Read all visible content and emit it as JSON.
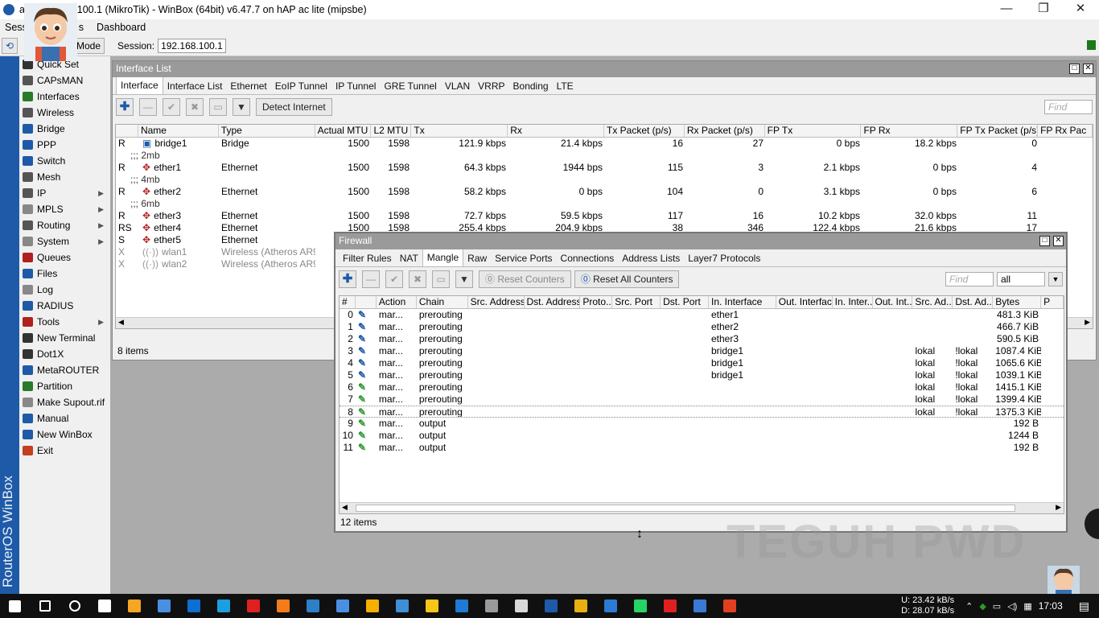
{
  "titlebar": {
    "title": "a    @192.168.100.1 (MikroTik) - WinBox (64bit) v6.47.7 on hAP ac lite (mipsbe)",
    "min": "—",
    "max": "❐",
    "close": "✕"
  },
  "menu": {
    "session": "Sess",
    "settings": "s",
    "dashboard": "Dashboard"
  },
  "toolbar": {
    "mode": "Mode",
    "session_label": "Session:",
    "session_value": "192.168.100.1"
  },
  "vertical_label": "RouterOS WinBox",
  "sidebar": {
    "items": [
      {
        "label": "Quick Set",
        "icon": "quick-set-icon",
        "arrow": false
      },
      {
        "label": "CAPsMAN",
        "icon": "capsman-icon",
        "arrow": false
      },
      {
        "label": "Interfaces",
        "icon": "interfaces-icon",
        "arrow": false
      },
      {
        "label": "Wireless",
        "icon": "wireless-icon",
        "arrow": false
      },
      {
        "label": "Bridge",
        "icon": "bridge-icon",
        "arrow": false
      },
      {
        "label": "PPP",
        "icon": "ppp-icon",
        "arrow": false
      },
      {
        "label": "Switch",
        "icon": "switch-icon",
        "arrow": false
      },
      {
        "label": "Mesh",
        "icon": "mesh-icon",
        "arrow": false
      },
      {
        "label": "IP",
        "icon": "ip-icon",
        "arrow": true
      },
      {
        "label": "MPLS",
        "icon": "mpls-icon",
        "arrow": true
      },
      {
        "label": "Routing",
        "icon": "routing-icon",
        "arrow": true
      },
      {
        "label": "System",
        "icon": "system-icon",
        "arrow": true
      },
      {
        "label": "Queues",
        "icon": "queues-icon",
        "arrow": false
      },
      {
        "label": "Files",
        "icon": "files-icon",
        "arrow": false
      },
      {
        "label": "Log",
        "icon": "log-icon",
        "arrow": false
      },
      {
        "label": "RADIUS",
        "icon": "radius-icon",
        "arrow": false
      },
      {
        "label": "Tools",
        "icon": "tools-icon",
        "arrow": true
      },
      {
        "label": "New Terminal",
        "icon": "terminal-icon",
        "arrow": false
      },
      {
        "label": "Dot1X",
        "icon": "dot1x-icon",
        "arrow": false
      },
      {
        "label": "MetaROUTER",
        "icon": "metarouter-icon",
        "arrow": false
      },
      {
        "label": "Partition",
        "icon": "partition-icon",
        "arrow": false
      },
      {
        "label": "Make Supout.rif",
        "icon": "supout-icon",
        "arrow": false
      },
      {
        "label": "Manual",
        "icon": "manual-icon",
        "arrow": false
      },
      {
        "label": "New WinBox",
        "icon": "winbox-icon",
        "arrow": false
      },
      {
        "label": "Exit",
        "icon": "exit-icon",
        "arrow": false
      }
    ]
  },
  "interface_list": {
    "title": "Interface List",
    "tabs": [
      "Interface",
      "Interface List",
      "Ethernet",
      "EoIP Tunnel",
      "IP Tunnel",
      "GRE Tunnel",
      "VLAN",
      "VRRP",
      "Bonding",
      "LTE"
    ],
    "detect_internet": "Detect Internet",
    "find_placeholder": "Find",
    "columns": [
      "",
      "Name",
      "Type",
      "Actual MTU",
      "L2 MTU",
      "Tx",
      "Rx",
      "Tx Packet (p/s)",
      "Rx Packet (p/s)",
      "FP Tx",
      "FP Rx",
      "FP Tx Packet (p/s)",
      "FP Rx Pac"
    ],
    "rows": [
      {
        "flag": "R",
        "name": "bridge1",
        "type": "Bridge",
        "mtu": "1500",
        "l2mtu": "1598",
        "tx": "121.9 kbps",
        "rx": "21.4 kbps",
        "txp": "16",
        "rxp": "27",
        "fptx": "0 bps",
        "fprx": "18.2 kbps",
        "fptxp": "0",
        "comment": null,
        "disabled": false
      },
      {
        "flag": "R",
        "name": "ether1",
        "type": "Ethernet",
        "mtu": "1500",
        "l2mtu": "1598",
        "tx": "64.3 kbps",
        "rx": "1944 bps",
        "txp": "115",
        "rxp": "3",
        "fptx": "2.1 kbps",
        "fprx": "0 bps",
        "fptxp": "4",
        "comment": ";;; 2mb",
        "disabled": false
      },
      {
        "flag": "R",
        "name": "ether2",
        "type": "Ethernet",
        "mtu": "1500",
        "l2mtu": "1598",
        "tx": "58.2 kbps",
        "rx": "0 bps",
        "txp": "104",
        "rxp": "0",
        "fptx": "3.1 kbps",
        "fprx": "0 bps",
        "fptxp": "6",
        "comment": ";;; 4mb",
        "disabled": false
      },
      {
        "flag": "R",
        "name": "ether3",
        "type": "Ethernet",
        "mtu": "1500",
        "l2mtu": "1598",
        "tx": "72.7 kbps",
        "rx": "59.5 kbps",
        "txp": "117",
        "rxp": "16",
        "fptx": "10.2 kbps",
        "fprx": "32.0 kbps",
        "fptxp": "11",
        "comment": ";;; 6mb",
        "disabled": false
      },
      {
        "flag": "RS",
        "name": "ether4",
        "type": "Ethernet",
        "mtu": "1500",
        "l2mtu": "1598",
        "tx": "255.4 kbps",
        "rx": "204.9 kbps",
        "txp": "38",
        "rxp": "346",
        "fptx": "122.4 kbps",
        "fprx": "21.6 kbps",
        "fptxp": "17",
        "comment": null,
        "disabled": false
      },
      {
        "flag": "S",
        "name": "ether5",
        "type": "Ethernet",
        "mtu": "",
        "l2mtu": "",
        "tx": "",
        "rx": "",
        "txp": "",
        "rxp": "",
        "fptx": "",
        "fprx": "",
        "fptxp": "",
        "comment": null,
        "disabled": false
      },
      {
        "flag": "X",
        "name": "wlan1",
        "type": "Wireless (Atheros AR9...",
        "mtu": "",
        "l2mtu": "",
        "tx": "",
        "rx": "",
        "txp": "",
        "rxp": "",
        "fptx": "",
        "fprx": "",
        "fptxp": "",
        "comment": null,
        "disabled": true
      },
      {
        "flag": "X",
        "name": "wlan2",
        "type": "Wireless (Atheros AR9...",
        "mtu": "",
        "l2mtu": "",
        "tx": "",
        "rx": "",
        "txp": "",
        "rxp": "",
        "fptx": "",
        "fprx": "",
        "fptxp": "",
        "comment": null,
        "disabled": true
      }
    ],
    "status": "8 items"
  },
  "firewall": {
    "title": "Firewall",
    "tabs": [
      "Filter Rules",
      "NAT",
      "Mangle",
      "Raw",
      "Service Ports",
      "Connections",
      "Address Lists",
      "Layer7 Protocols"
    ],
    "reset_counters": "Reset Counters",
    "reset_all_counters": "Reset All Counters",
    "find_placeholder": "Find",
    "filter_value": "all",
    "columns": [
      "#",
      "",
      "Action",
      "Chain",
      "Src. Address",
      "Dst. Address",
      "Proto...",
      "Src. Port",
      "Dst. Port",
      "In. Interface",
      "Out. Interface",
      "In. Inter...",
      "Out. Int...",
      "Src. Ad...",
      "Dst. Ad...",
      "Bytes",
      "P"
    ],
    "rows": [
      {
        "num": "0",
        "action": "mar...",
        "chain": "prerouting",
        "in": "ether1",
        "src": "",
        "dst": "",
        "bytes": "481.3 KiB",
        "color": "#1e5aa8"
      },
      {
        "num": "1",
        "action": "mar...",
        "chain": "prerouting",
        "in": "ether2",
        "src": "",
        "dst": "",
        "bytes": "466.7 KiB",
        "color": "#1e5aa8"
      },
      {
        "num": "2",
        "action": "mar...",
        "chain": "prerouting",
        "in": "ether3",
        "src": "",
        "dst": "",
        "bytes": "590.5 KiB",
        "color": "#1e5aa8"
      },
      {
        "num": "3",
        "action": "mar...",
        "chain": "prerouting",
        "in": "bridge1",
        "src": "lokal",
        "dst": "!lokal",
        "bytes": "1087.4 KiB",
        "color": "#1e5aa8"
      },
      {
        "num": "4",
        "action": "mar...",
        "chain": "prerouting",
        "in": "bridge1",
        "src": "lokal",
        "dst": "!lokal",
        "bytes": "1065.6 KiB",
        "color": "#1e5aa8"
      },
      {
        "num": "5",
        "action": "mar...",
        "chain": "prerouting",
        "in": "bridge1",
        "src": "lokal",
        "dst": "!lokal",
        "bytes": "1039.1 KiB",
        "color": "#1e5aa8"
      },
      {
        "num": "6",
        "action": "mar...",
        "chain": "prerouting",
        "in": "",
        "src": "lokal",
        "dst": "!lokal",
        "bytes": "1415.1 KiB",
        "color": "#2e9a2e"
      },
      {
        "num": "7",
        "action": "mar...",
        "chain": "prerouting",
        "in": "",
        "src": "lokal",
        "dst": "!lokal",
        "bytes": "1399.4 KiB",
        "color": "#2e9a2e"
      },
      {
        "num": "8",
        "action": "mar...",
        "chain": "prerouting",
        "in": "",
        "src": "lokal",
        "dst": "!lokal",
        "bytes": "1375.3 KiB",
        "color": "#2e9a2e"
      },
      {
        "num": "9",
        "action": "mar...",
        "chain": "output",
        "in": "",
        "src": "",
        "dst": "",
        "bytes": "192 B",
        "color": "#2e9a2e"
      },
      {
        "num": "10",
        "action": "mar...",
        "chain": "output",
        "in": "",
        "src": "",
        "dst": "",
        "bytes": "1244 B",
        "color": "#2e9a2e"
      },
      {
        "num": "11",
        "action": "mar...",
        "chain": "output",
        "in": "",
        "src": "",
        "dst": "",
        "bytes": "192 B",
        "color": "#2e9a2e"
      }
    ],
    "status": "12 items"
  },
  "watermark": "TEGUH PWD",
  "taskbar": {
    "icons": [
      "start-icon",
      "search-icon",
      "cortana-icon",
      "task-view-icon",
      "store-icon",
      "app-icon",
      "mail-icon",
      "edge-icon",
      "opera-icon",
      "firefox-icon",
      "notes-icon",
      "gear-app-icon",
      "media-icon",
      "photos-icon",
      "explorer-icon",
      "vscode-icon",
      "paint-icon",
      "speed-icon",
      "winbox-icon",
      "chrome-icon",
      "remote-icon",
      "whatsapp-icon",
      "youtube-icon",
      "capture-icon",
      "app2-icon"
    ],
    "colors": [
      "#ffffff",
      "#ffffff",
      "#ffffff",
      "#ffffff",
      "#f5a623",
      "#4a90e2",
      "#0b6fd4",
      "#1aa0e0",
      "#e02020",
      "#f57c1a",
      "#2c80c8",
      "#4a90e2",
      "#f5b000",
      "#3e8ed8",
      "#f5c518",
      "#1e7ad4",
      "#9a9a9a",
      "#d8d8d8",
      "#1e5aa8",
      "#e8b010",
      "#2c7ad4",
      "#25d366",
      "#e02020",
      "#3a7ad4",
      "#e04020"
    ],
    "net_up": "U:   23.42 kB/s",
    "net_down": "D:   28.07 kB/s",
    "clock": "17:03"
  }
}
